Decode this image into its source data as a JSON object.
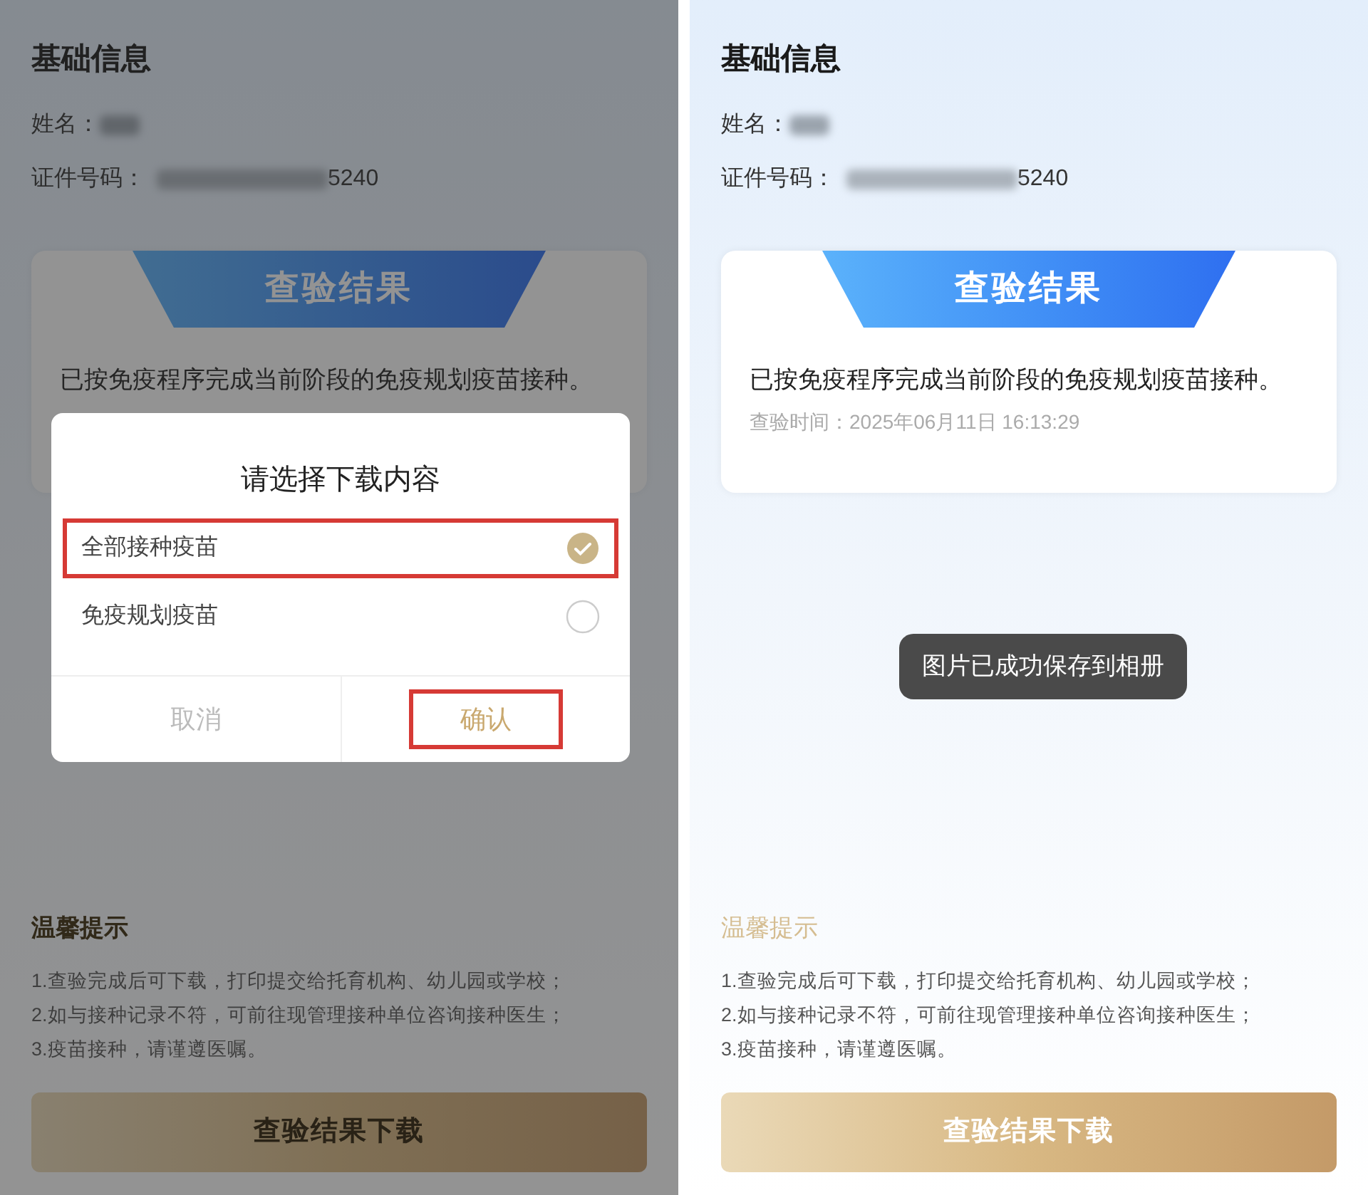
{
  "screens": [
    {
      "title": "基础信息",
      "name_label": "姓名：",
      "id_label": "证件号码：",
      "id_suffix": "5240",
      "result_tab": "查验结果",
      "result_text": "已按免疫程序完成当前阶段的免疫规划疫苗接种。",
      "tips_title": "温馨提示",
      "tips": [
        "1.查验完成后可下载，打印提交给托育机构、幼儿园或学校；",
        "2.如与接种记录不符，可前往现管理接种单位咨询接种医生；",
        "3.疫苗接种，请谨遵医嘱。"
      ],
      "download_button": "查验结果下载",
      "dimmed": true,
      "dialog": {
        "title": "请选择下载内容",
        "options": [
          {
            "label": "全部接种疫苗",
            "selected": true,
            "highlighted": true
          },
          {
            "label": "免疫规划疫苗",
            "selected": false,
            "highlighted": false
          }
        ],
        "cancel": "取消",
        "confirm": {
          "label": "确认",
          "highlighted": true
        }
      }
    },
    {
      "title": "基础信息",
      "name_label": "姓名：",
      "id_label": "证件号码：",
      "id_suffix": "5240",
      "result_tab": "查验结果",
      "result_text": "已按免疫程序完成当前阶段的免疫规划疫苗接种。",
      "check_time": "查验时间：2025年06月11日 16:13:29",
      "tips_title": "温馨提示",
      "tips": [
        "1.查验完成后可下载，打印提交给托育机构、幼儿园或学校；",
        "2.如与接种记录不符，可前往现管理接种单位咨询接种医生；",
        "3.疫苗接种，请谨遵医嘱。"
      ],
      "download_button": "查验结果下载",
      "dimmed": false,
      "toast": "图片已成功保存到相册"
    }
  ]
}
